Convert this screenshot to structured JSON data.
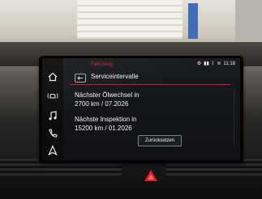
{
  "status_bar": {
    "icons": [
      "gear-icon",
      "signal-icon",
      "bluetooth-icon",
      "phone-icon",
      "wifi-icon"
    ],
    "time": "11:18"
  },
  "breadcrumb": "Fahrzeug",
  "header": {
    "title": "Serviceintervalle"
  },
  "service": {
    "oil_change_label": "Nächster Ölwechsel in",
    "oil_change_value": "2700 km / 07.2026",
    "inspection_label": "Nächste Inspektion in",
    "inspection_value": "15200 km / 01.2026",
    "reset_label": "Zurücksetzen"
  },
  "sidebar": {
    "items": [
      {
        "icon": "home-icon"
      },
      {
        "icon": "car-wireless-icon"
      },
      {
        "icon": "music-note-icon"
      },
      {
        "icon": "phone-icon"
      },
      {
        "icon": "navigation-icon"
      }
    ]
  },
  "colors": {
    "accent": "#d21c2c",
    "screen_bg": "#14171b",
    "text": "#f2f2f2"
  }
}
